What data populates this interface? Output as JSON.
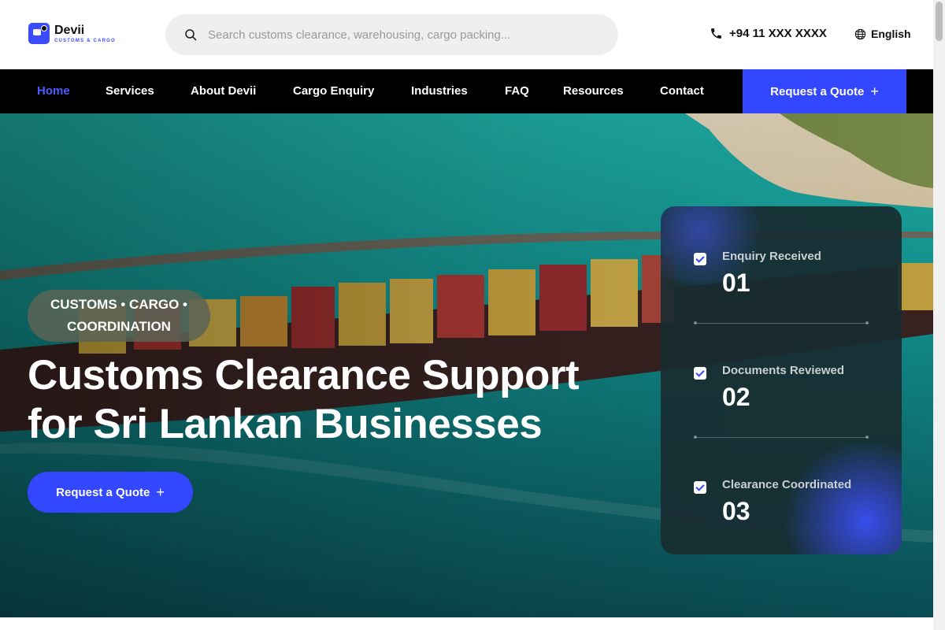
{
  "brand": {
    "name": "Devii",
    "tagline": "CUSTOMS & CARGO",
    "accent": "#3347ff"
  },
  "search": {
    "placeholder": "Search customs clearance, warehousing, cargo packing..."
  },
  "contact": {
    "phone": "+94 11 XXX XXXX",
    "language": "English"
  },
  "nav": {
    "items": [
      {
        "label": "Home",
        "active": true
      },
      {
        "label": "Services"
      },
      {
        "label": "About Devii"
      },
      {
        "label": "Cargo Enquiry"
      },
      {
        "label": "Industries"
      },
      {
        "label": "FAQ"
      },
      {
        "label": "Resources"
      },
      {
        "label": "Contact"
      }
    ],
    "cta_label": "Request a Quote",
    "cta_icon": "plus-icon"
  },
  "hero": {
    "badge_line1": "CUSTOMS • CARGO •",
    "badge_line2": "COORDINATION",
    "title_line1": "Customs Clearance Support",
    "title_line2": "for Sri Lankan Businesses",
    "cta_label": "Request a Quote",
    "cta_icon": "plus-icon"
  },
  "steps": [
    {
      "label": "Enquiry Received",
      "number": "01",
      "icon": "checkbox-checked-icon"
    },
    {
      "label": "Documents Reviewed",
      "number": "02",
      "icon": "checkbox-checked-icon"
    },
    {
      "label": "Clearance Coordinated",
      "number": "03",
      "icon": "checkbox-checked-icon"
    }
  ]
}
